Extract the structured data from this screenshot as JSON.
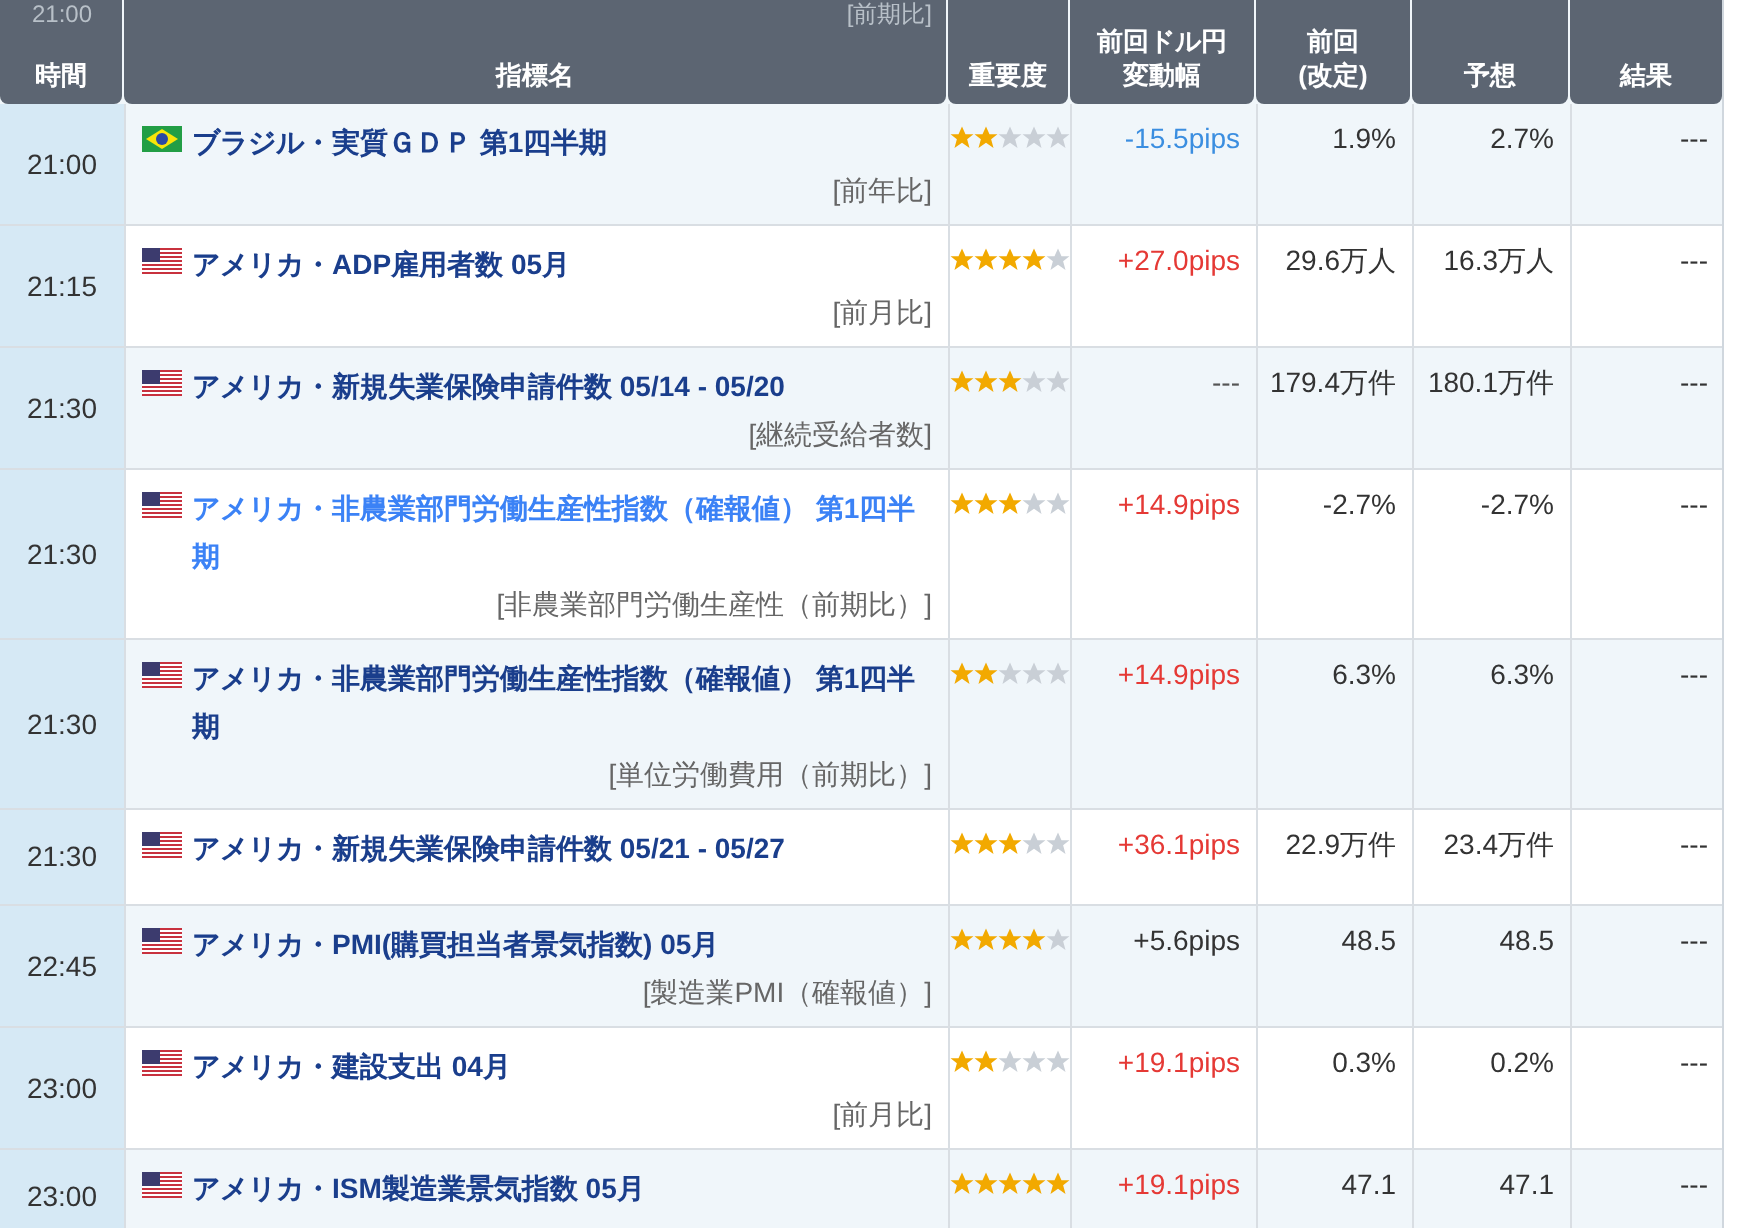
{
  "header": [
    {
      "lines": [
        "時間"
      ]
    },
    {
      "lines": [
        "指標名"
      ]
    },
    {
      "lines": [
        "重要度"
      ]
    },
    {
      "lines": [
        "前回ドル円",
        "変動幅"
      ]
    },
    {
      "lines": [
        "前回",
        "(改定)"
      ]
    },
    {
      "lines": [
        "予想"
      ]
    },
    {
      "lines": [
        "結果"
      ]
    }
  ],
  "partial_row": {
    "time": "21:00",
    "note": "[前期比]"
  },
  "rows": [
    {
      "time": "21:00",
      "flag": {
        "kind": "brazil"
      },
      "name": "ブラジル・実質ＧＤＰ 第1四半期",
      "highlighted": false,
      "note": "[前年比]",
      "stars": 2,
      "change": {
        "text": "-15.5pips",
        "kind": "down"
      },
      "previous": "1.9%",
      "forecast": "2.7%",
      "result": "---"
    },
    {
      "time": "21:15",
      "flag": {
        "kind": "us"
      },
      "name": "アメリカ・ADP雇用者数 05月",
      "highlighted": false,
      "note": "[前月比]",
      "stars": 4,
      "change": {
        "text": "+27.0pips",
        "kind": "up"
      },
      "previous": "29.6万人",
      "forecast": "16.3万人",
      "result": "---"
    },
    {
      "time": "21:30",
      "flag": {
        "kind": "us"
      },
      "name": "アメリカ・新規失業保険申請件数 05/14 - 05/20",
      "highlighted": false,
      "note": "[継続受給者数]",
      "stars": 3,
      "change": {
        "text": "---",
        "kind": "none"
      },
      "previous": "179.4万件",
      "forecast": "180.1万件",
      "result": "---"
    },
    {
      "time": "21:30",
      "flag": {
        "kind": "us"
      },
      "name": "アメリカ・非農業部門労働生産性指数（確報値） 第1四半期",
      "highlighted": true,
      "note": "[非農業部門労働生産性（前期比）]",
      "stars": 3,
      "change": {
        "text": "+14.9pips",
        "kind": "up"
      },
      "previous": "-2.7%",
      "forecast": "-2.7%",
      "result": "---"
    },
    {
      "time": "21:30",
      "flag": {
        "kind": "us"
      },
      "name": "アメリカ・非農業部門労働生産性指数（確報値） 第1四半期",
      "highlighted": false,
      "note": "[単位労働費用（前期比）]",
      "stars": 2,
      "change": {
        "text": "+14.9pips",
        "kind": "up"
      },
      "previous": "6.3%",
      "forecast": "6.3%",
      "result": "---"
    },
    {
      "time": "21:30",
      "flag": {
        "kind": "us"
      },
      "name": "アメリカ・新規失業保険申請件数 05/21 - 05/27",
      "highlighted": false,
      "stars": 3,
      "change": {
        "text": "+36.1pips",
        "kind": "up"
      },
      "previous": "22.9万件",
      "forecast": "23.4万件",
      "result": "---"
    },
    {
      "time": "22:45",
      "flag": {
        "kind": "us"
      },
      "name": "アメリカ・PMI(購買担当者景気指数) 05月",
      "highlighted": false,
      "note": "[製造業PMI（確報値）]",
      "stars": 4,
      "change": {
        "text": "+5.6pips",
        "kind": "flat"
      },
      "previous": "48.5",
      "forecast": "48.5",
      "result": "---"
    },
    {
      "time": "23:00",
      "flag": {
        "kind": "us"
      },
      "name": "アメリカ・建設支出 04月",
      "highlighted": false,
      "note": "[前月比]",
      "stars": 2,
      "change": {
        "text": "+19.1pips",
        "kind": "up"
      },
      "previous": "0.3%",
      "forecast": "0.2%",
      "result": "---"
    },
    {
      "time": "23:00",
      "flag": {
        "kind": "us"
      },
      "name": "アメリカ・ISM製造業景気指数 05月",
      "highlighted": false,
      "stars": 5,
      "change": {
        "text": "+19.1pips",
        "kind": "up"
      },
      "previous": "47.1",
      "forecast": "47.1",
      "result": "---"
    }
  ]
}
